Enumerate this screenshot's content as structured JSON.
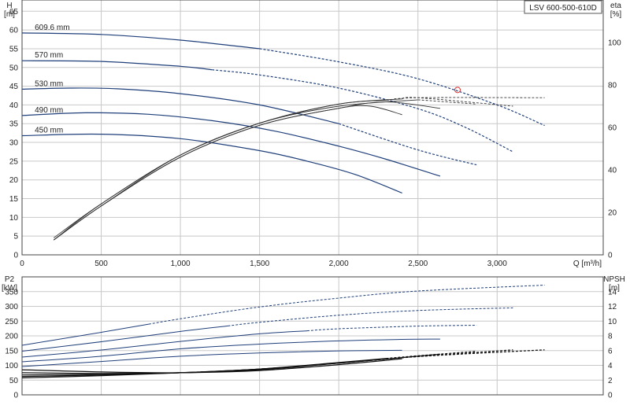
{
  "model": "LSV 600-500-610D",
  "colors": {
    "grid": "#c8c8c8",
    "head_curve": "#1f3f7a",
    "eff_curve": "#333333",
    "p2_curve": "#1f3f7a",
    "npsh_curve": "#111111",
    "duty_point": "#e03030"
  },
  "chart_data": [
    {
      "type": "line",
      "name": "head-efficiency",
      "x_axis": {
        "label": "Q [m³/h]",
        "ticks": [
          0,
          500,
          1000,
          1500,
          2000,
          2500,
          3000
        ],
        "tick_labels": [
          "0",
          "500",
          "1,000",
          "1,500",
          "2,000",
          "2,500",
          "3,000"
        ],
        "range": [
          0,
          3670
        ]
      },
      "y_axis_left": {
        "label_line1": "H",
        "label_line2": "[m]",
        "range": [
          0,
          68
        ],
        "ticks": [
          0,
          5,
          10,
          15,
          20,
          25,
          30,
          35,
          40,
          45,
          50,
          55,
          60,
          65
        ]
      },
      "y_axis_right": {
        "label_line1": "eta",
        "label_line2": "[%]",
        "range": [
          0,
          120
        ],
        "ticks": [
          0,
          20,
          40,
          60,
          80,
          100
        ]
      },
      "head_series": [
        {
          "name": "609.6 mm",
          "solid": [
            [
              0,
              59.2
            ],
            [
              500,
              58.8
            ],
            [
              1000,
              57.3
            ],
            [
              1500,
              55.0
            ],
            [
              2000,
              51.5
            ],
            [
              2500,
              47.0
            ],
            [
              3000,
              40.0
            ],
            [
              3300,
              34.5
            ]
          ],
          "solid_to": 0
        },
        {
          "name": "570 mm",
          "solid": [
            [
              0,
              51.8
            ],
            [
              500,
              51.6
            ],
            [
              1000,
              50.3
            ],
            [
              1500,
              48.0
            ],
            [
              2000,
              44.5
            ],
            [
              2500,
              39.0
            ],
            [
              2800,
              34.0
            ],
            [
              3100,
              27.5
            ]
          ],
          "solid_to": 0
        },
        {
          "name": "530 mm",
          "solid": [
            [
              0,
              44.2
            ],
            [
              300,
              44.5
            ],
            [
              600,
              44.3
            ],
            [
              1000,
              43.0
            ],
            [
              1500,
              40.0
            ],
            [
              2000,
              35.0
            ],
            [
              2500,
              28.0
            ],
            [
              2870,
              24.0
            ]
          ],
          "solid_to": 2000
        },
        {
          "name": "490 mm",
          "solid": [
            [
              0,
              37.2
            ],
            [
              400,
              37.9
            ],
            [
              800,
              37.5
            ],
            [
              1200,
              35.8
            ],
            [
              1600,
              33.0
            ],
            [
              2000,
              29.0
            ],
            [
              2300,
              25.5
            ],
            [
              2640,
              21.0
            ]
          ],
          "solid_to": 2640
        },
        {
          "name": "450 mm",
          "solid": [
            [
              0,
              31.8
            ],
            [
              500,
              32.2
            ],
            [
              1000,
              31.0
            ],
            [
              1500,
              27.8
            ],
            [
              1800,
              25.0
            ],
            [
              2100,
              21.5
            ],
            [
              2400,
              16.5
            ]
          ],
          "solid_to": 2400
        }
      ],
      "efficiency_series": [
        {
          "name": "450",
          "points": [
            [
              200,
              7
            ],
            [
              500,
              23
            ],
            [
              1000,
              46
            ],
            [
              1500,
              61
            ],
            [
              2000,
              69
            ],
            [
              2200,
              70
            ],
            [
              2400,
              66
            ]
          ],
          "solid_to": 2400
        },
        {
          "name": "490",
          "points": [
            [
              200,
              7
            ],
            [
              500,
              23
            ],
            [
              1000,
              46
            ],
            [
              1500,
              61
            ],
            [
              2000,
              69
            ],
            [
              2300,
              72
            ],
            [
              2640,
              69
            ]
          ],
          "solid_to": 2640
        },
        {
          "name": "530",
          "points": [
            [
              200,
              7
            ],
            [
              500,
              23
            ],
            [
              1000,
              47
            ],
            [
              1500,
              62
            ],
            [
              2000,
              70
            ],
            [
              2500,
              73
            ],
            [
              2870,
              71
            ]
          ],
          "solid_to": 2500
        },
        {
          "name": "570",
          "points": [
            [
              200,
              7
            ],
            [
              500,
              24
            ],
            [
              1000,
              47
            ],
            [
              1500,
              62
            ],
            [
              2000,
              71
            ],
            [
              2500,
              74
            ],
            [
              3100,
              70
            ]
          ],
          "solid_to": 2400
        },
        {
          "name": "609.6",
          "points": [
            [
              200,
              8
            ],
            [
              500,
              24
            ],
            [
              1000,
              47
            ],
            [
              1500,
              62
            ],
            [
              2000,
              71
            ],
            [
              2500,
              74
            ],
            [
              3300,
              74
            ]
          ],
          "solid_to": 2300
        }
      ],
      "duty_point": {
        "q": 2750,
        "h": 44
      }
    },
    {
      "type": "line",
      "name": "power-npsh",
      "x_axis": {
        "range": [
          0,
          3670
        ]
      },
      "y_axis_left": {
        "label_line1": "P2",
        "label_line2": "[kW]",
        "range": [
          0,
          400
        ],
        "ticks": [
          0,
          50,
          100,
          150,
          200,
          250,
          300,
          350
        ]
      },
      "y_axis_right": {
        "label_line1": "NPSH",
        "label_line2": "[m]",
        "range": [
          0,
          16
        ],
        "ticks": [
          0,
          2,
          4,
          6,
          8,
          10,
          12,
          14
        ]
      },
      "p2_series": [
        {
          "name": "609.6 mm",
          "points": [
            [
              0,
              168
            ],
            [
              500,
              212
            ],
            [
              1000,
              258
            ],
            [
              1500,
              298
            ],
            [
              2000,
              328
            ],
            [
              2500,
              352
            ],
            [
              3300,
              372
            ]
          ],
          "solid_to": 800
        },
        {
          "name": "570 mm",
          "points": [
            [
              0,
              148
            ],
            [
              500,
              180
            ],
            [
              1000,
              215
            ],
            [
              1500,
              246
            ],
            [
              2000,
              270
            ],
            [
              2500,
              286
            ],
            [
              3100,
              295
            ]
          ],
          "solid_to": 1300
        },
        {
          "name": "530 mm",
          "points": [
            [
              0,
              128
            ],
            [
              500,
              152
            ],
            [
              1000,
              181
            ],
            [
              1500,
              207
            ],
            [
              2000,
              224
            ],
            [
              2500,
              233
            ],
            [
              2870,
              236
            ]
          ],
          "solid_to": 1800
        },
        {
          "name": "490 mm",
          "points": [
            [
              0,
              112
            ],
            [
              500,
              131
            ],
            [
              1000,
              156
            ],
            [
              1500,
              172
            ],
            [
              2000,
              183
            ],
            [
              2400,
              188
            ],
            [
              2640,
              189
            ]
          ],
          "solid_to": 2640
        },
        {
          "name": "450 mm",
          "points": [
            [
              0,
              96
            ],
            [
              500,
              113
            ],
            [
              1000,
              131
            ],
            [
              1500,
              142
            ],
            [
              2000,
              149
            ],
            [
              2400,
              151
            ]
          ],
          "solid_to": 2400
        }
      ],
      "npsh_series": [
        {
          "name": "450",
          "points": [
            [
              0,
              3.4
            ],
            [
              500,
              3.1
            ],
            [
              1000,
              3.0
            ],
            [
              1500,
              3.3
            ],
            [
              2000,
              4.1
            ],
            [
              2400,
              4.9
            ]
          ],
          "solid_to": 2400
        },
        {
          "name": "490",
          "points": [
            [
              0,
              3.0
            ],
            [
              500,
              2.9
            ],
            [
              1000,
              3.0
            ],
            [
              1500,
              3.4
            ],
            [
              2000,
              4.3
            ],
            [
              2640,
              5.5
            ]
          ],
          "solid_to": 2640
        },
        {
          "name": "530",
          "points": [
            [
              0,
              2.7
            ],
            [
              500,
              2.8
            ],
            [
              1000,
              3.0
            ],
            [
              1500,
              3.5
            ],
            [
              2000,
              4.4
            ],
            [
              2500,
              5.3
            ],
            [
              2870,
              5.9
            ]
          ],
          "solid_to": 2300
        },
        {
          "name": "570",
          "points": [
            [
              0,
              2.5
            ],
            [
              500,
              2.7
            ],
            [
              1000,
              3.0
            ],
            [
              1500,
              3.5
            ],
            [
              2000,
              4.3
            ],
            [
              2500,
              5.2
            ],
            [
              3100,
              6.1
            ]
          ],
          "solid_to": 2200
        },
        {
          "name": "609.6",
          "points": [
            [
              0,
              2.3
            ],
            [
              500,
              2.6
            ],
            [
              1000,
              3.0
            ],
            [
              1500,
              3.5
            ],
            [
              2000,
              4.3
            ],
            [
              2500,
              5.2
            ],
            [
              3300,
              6.1
            ]
          ],
          "solid_to": 2100
        }
      ]
    }
  ]
}
